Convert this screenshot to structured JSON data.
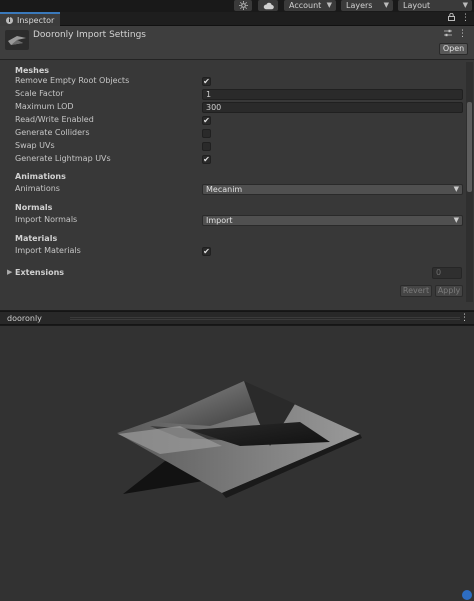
{
  "toolbar": {
    "account_label": "Account",
    "layers_label": "Layers",
    "layout_label": "Layout"
  },
  "tab": {
    "label": "Inspector"
  },
  "inspector": {
    "title": "Dooronly Import Settings",
    "open_label": "Open",
    "meshes": {
      "section": "Meshes",
      "remove_empty_root_objects": {
        "label": "Remove Empty Root Objects",
        "checked": true
      },
      "scale_factor": {
        "label": "Scale Factor",
        "value": "1"
      },
      "maximum_lod": {
        "label": "Maximum LOD",
        "value": "300"
      },
      "read_write_enabled": {
        "label": "Read/Write Enabled",
        "checked": true
      },
      "generate_colliders": {
        "label": "Generate Colliders",
        "checked": false
      },
      "swap_uvs": {
        "label": "Swap UVs",
        "checked": false
      },
      "generate_lightmap_uvs": {
        "label": "Generate Lightmap UVs",
        "checked": true
      }
    },
    "animations": {
      "section": "Animations",
      "label": "Animations",
      "value": "Mecanim"
    },
    "normals": {
      "section": "Normals",
      "label": "Import Normals",
      "value": "Import"
    },
    "materials": {
      "section": "Materials",
      "label": "Import Materials",
      "checked": true
    },
    "extensions": {
      "label": "Extensions",
      "count": "0"
    },
    "revert_label": "Revert",
    "apply_label": "Apply"
  },
  "preview": {
    "name": "dooronly"
  },
  "check_glyph": "✔"
}
